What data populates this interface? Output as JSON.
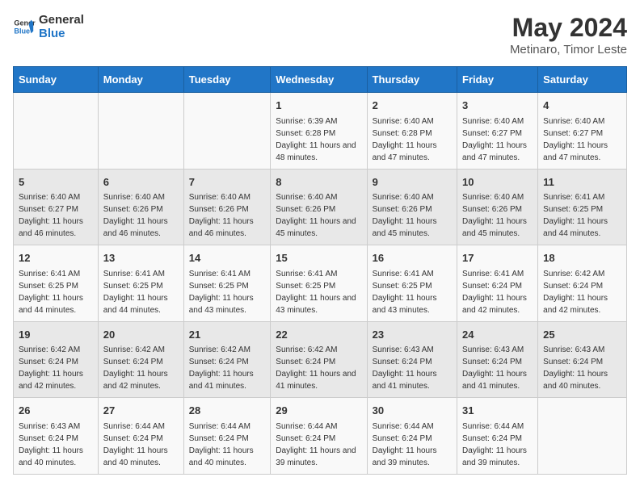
{
  "logo": {
    "line1": "General",
    "line2": "Blue"
  },
  "title": "May 2024",
  "subtitle": "Metinaro, Timor Leste",
  "days": [
    "Sunday",
    "Monday",
    "Tuesday",
    "Wednesday",
    "Thursday",
    "Friday",
    "Saturday"
  ],
  "weeks": [
    [
      {
        "day": "",
        "info": ""
      },
      {
        "day": "",
        "info": ""
      },
      {
        "day": "",
        "info": ""
      },
      {
        "day": "1",
        "info": "Sunrise: 6:39 AM\nSunset: 6:28 PM\nDaylight: 11 hours and 48 minutes."
      },
      {
        "day": "2",
        "info": "Sunrise: 6:40 AM\nSunset: 6:28 PM\nDaylight: 11 hours and 47 minutes."
      },
      {
        "day": "3",
        "info": "Sunrise: 6:40 AM\nSunset: 6:27 PM\nDaylight: 11 hours and 47 minutes."
      },
      {
        "day": "4",
        "info": "Sunrise: 6:40 AM\nSunset: 6:27 PM\nDaylight: 11 hours and 47 minutes."
      }
    ],
    [
      {
        "day": "5",
        "info": "Sunrise: 6:40 AM\nSunset: 6:27 PM\nDaylight: 11 hours and 46 minutes."
      },
      {
        "day": "6",
        "info": "Sunrise: 6:40 AM\nSunset: 6:26 PM\nDaylight: 11 hours and 46 minutes."
      },
      {
        "day": "7",
        "info": "Sunrise: 6:40 AM\nSunset: 6:26 PM\nDaylight: 11 hours and 46 minutes."
      },
      {
        "day": "8",
        "info": "Sunrise: 6:40 AM\nSunset: 6:26 PM\nDaylight: 11 hours and 45 minutes."
      },
      {
        "day": "9",
        "info": "Sunrise: 6:40 AM\nSunset: 6:26 PM\nDaylight: 11 hours and 45 minutes."
      },
      {
        "day": "10",
        "info": "Sunrise: 6:40 AM\nSunset: 6:26 PM\nDaylight: 11 hours and 45 minutes."
      },
      {
        "day": "11",
        "info": "Sunrise: 6:41 AM\nSunset: 6:25 PM\nDaylight: 11 hours and 44 minutes."
      }
    ],
    [
      {
        "day": "12",
        "info": "Sunrise: 6:41 AM\nSunset: 6:25 PM\nDaylight: 11 hours and 44 minutes."
      },
      {
        "day": "13",
        "info": "Sunrise: 6:41 AM\nSunset: 6:25 PM\nDaylight: 11 hours and 44 minutes."
      },
      {
        "day": "14",
        "info": "Sunrise: 6:41 AM\nSunset: 6:25 PM\nDaylight: 11 hours and 43 minutes."
      },
      {
        "day": "15",
        "info": "Sunrise: 6:41 AM\nSunset: 6:25 PM\nDaylight: 11 hours and 43 minutes."
      },
      {
        "day": "16",
        "info": "Sunrise: 6:41 AM\nSunset: 6:25 PM\nDaylight: 11 hours and 43 minutes."
      },
      {
        "day": "17",
        "info": "Sunrise: 6:41 AM\nSunset: 6:24 PM\nDaylight: 11 hours and 42 minutes."
      },
      {
        "day": "18",
        "info": "Sunrise: 6:42 AM\nSunset: 6:24 PM\nDaylight: 11 hours and 42 minutes."
      }
    ],
    [
      {
        "day": "19",
        "info": "Sunrise: 6:42 AM\nSunset: 6:24 PM\nDaylight: 11 hours and 42 minutes."
      },
      {
        "day": "20",
        "info": "Sunrise: 6:42 AM\nSunset: 6:24 PM\nDaylight: 11 hours and 42 minutes."
      },
      {
        "day": "21",
        "info": "Sunrise: 6:42 AM\nSunset: 6:24 PM\nDaylight: 11 hours and 41 minutes."
      },
      {
        "day": "22",
        "info": "Sunrise: 6:42 AM\nSunset: 6:24 PM\nDaylight: 11 hours and 41 minutes."
      },
      {
        "day": "23",
        "info": "Sunrise: 6:43 AM\nSunset: 6:24 PM\nDaylight: 11 hours and 41 minutes."
      },
      {
        "day": "24",
        "info": "Sunrise: 6:43 AM\nSunset: 6:24 PM\nDaylight: 11 hours and 41 minutes."
      },
      {
        "day": "25",
        "info": "Sunrise: 6:43 AM\nSunset: 6:24 PM\nDaylight: 11 hours and 40 minutes."
      }
    ],
    [
      {
        "day": "26",
        "info": "Sunrise: 6:43 AM\nSunset: 6:24 PM\nDaylight: 11 hours and 40 minutes."
      },
      {
        "day": "27",
        "info": "Sunrise: 6:44 AM\nSunset: 6:24 PM\nDaylight: 11 hours and 40 minutes."
      },
      {
        "day": "28",
        "info": "Sunrise: 6:44 AM\nSunset: 6:24 PM\nDaylight: 11 hours and 40 minutes."
      },
      {
        "day": "29",
        "info": "Sunrise: 6:44 AM\nSunset: 6:24 PM\nDaylight: 11 hours and 39 minutes."
      },
      {
        "day": "30",
        "info": "Sunrise: 6:44 AM\nSunset: 6:24 PM\nDaylight: 11 hours and 39 minutes."
      },
      {
        "day": "31",
        "info": "Sunrise: 6:44 AM\nSunset: 6:24 PM\nDaylight: 11 hours and 39 minutes."
      },
      {
        "day": "",
        "info": ""
      }
    ]
  ]
}
